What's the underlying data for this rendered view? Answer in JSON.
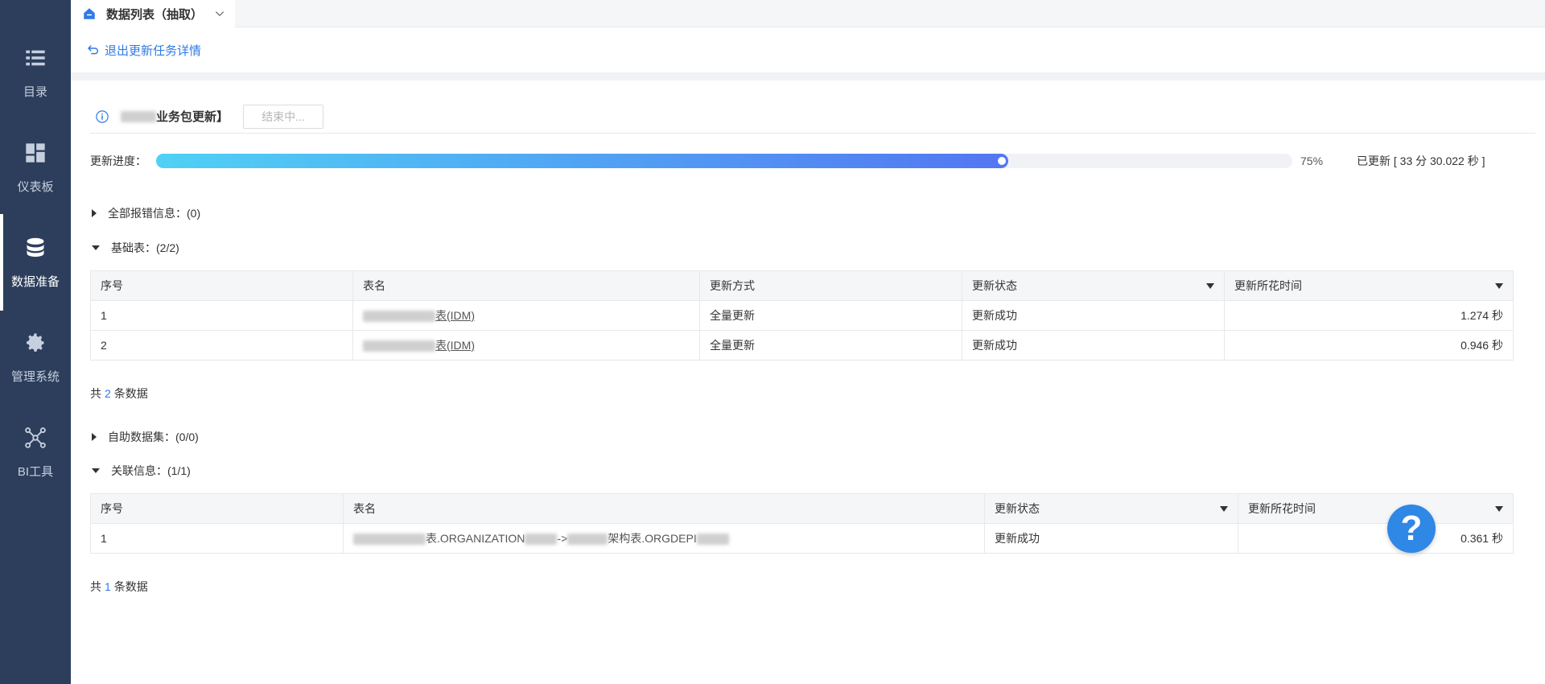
{
  "sidebar": {
    "items": [
      {
        "label": "目录",
        "icon": "list-icon"
      },
      {
        "label": "仪表板",
        "icon": "dashboard-icon"
      },
      {
        "label": "数据准备",
        "icon": "database-icon",
        "active": true
      },
      {
        "label": "管理系统",
        "icon": "gear-icon"
      },
      {
        "label": "BI工具",
        "icon": "network-icon"
      }
    ]
  },
  "tab": {
    "title": "数据列表（抽取）"
  },
  "back": {
    "label": "退出更新任务详情"
  },
  "task": {
    "name_suffix": "业务包更新】",
    "status_label": "结束中..."
  },
  "progress": {
    "label": "更新进度：",
    "value": 75,
    "percent_text": "75%",
    "elapsed": "已更新 [ 33 分 30.022 秒 ]"
  },
  "sections": {
    "errors": {
      "title": "全部报错信息：(0)"
    },
    "base_tables": {
      "title": "基础表：(2/2)"
    },
    "self_datasets": {
      "title": "自助数据集：(0/0)"
    },
    "relations": {
      "title": "关联信息：(1/1)"
    }
  },
  "base_table": {
    "headers": [
      "序号",
      "表名",
      "更新方式",
      "更新状态",
      "更新所花时间"
    ],
    "rows": [
      {
        "no": "1",
        "name": "表(IDM)",
        "method": "全量更新",
        "status": "更新成功",
        "time": "1.274 秒"
      },
      {
        "no": "2",
        "name": "表(IDM)",
        "method": "全量更新",
        "status": "更新成功",
        "time": "0.946 秒"
      }
    ],
    "total_prefix": "共",
    "total_count": "2",
    "total_suffix": "条数据"
  },
  "relation_table": {
    "headers": [
      "序号",
      "表名",
      "更新状态",
      "更新所花时间"
    ],
    "rows": [
      {
        "no": "1",
        "name_a": "表.ORGANIZATION",
        "arrow": "->",
        "name_b": "架构表.ORGDEPI",
        "status": "更新成功",
        "time": "0.361 秒"
      }
    ],
    "total_prefix": "共",
    "total_count": "1",
    "total_suffix": "条数据"
  },
  "help": {
    "label": "?"
  }
}
